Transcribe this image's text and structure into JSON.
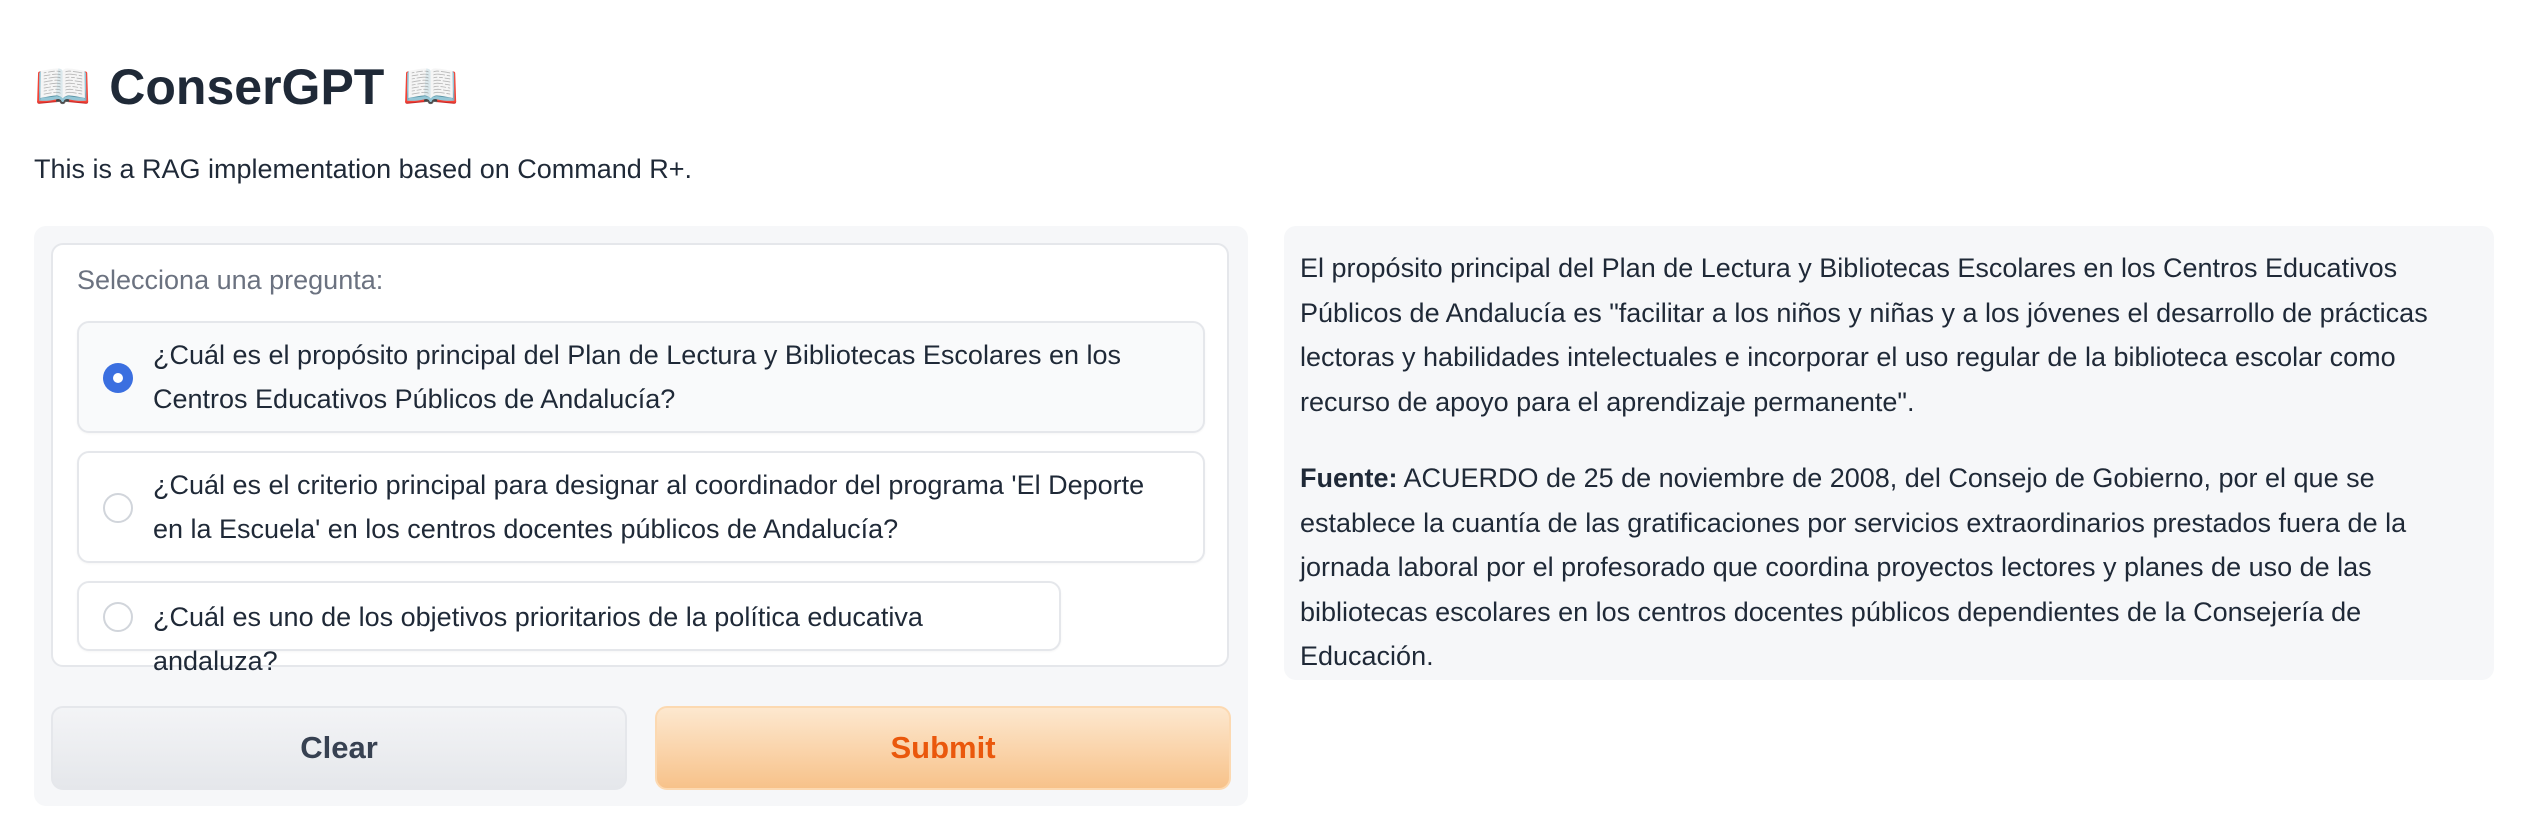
{
  "app": {
    "title": "ConserGPT",
    "title_icon": "open-book-icon",
    "description": "This is a RAG implementation based on Command R+."
  },
  "question_selector": {
    "label": "Selecciona una pregunta:",
    "selected_index": 0,
    "options": [
      "¿Cuál es el propósito principal del Plan de Lectura y Bibliotecas Escolares en los Centros Educativos Públicos de Andalucía?",
      "¿Cuál es el criterio principal para designar al coordinador del programa 'El Deporte en la Escuela' en los centros docentes públicos de Andalucía?",
      "¿Cuál es uno de los objetivos prioritarios de la política educativa andaluza?"
    ]
  },
  "buttons": {
    "clear_label": "Clear",
    "submit_label": "Submit"
  },
  "answer": {
    "text": "El propósito principal del Plan de Lectura y Bibliotecas Escolares en los Centros Educativos Públicos de Andalucía es \"facilitar a los niños y niñas y a los jóvenes el desarrollo de prácticas lectoras y habilidades intelectuales e incorporar el uso regular de la biblioteca escolar como recurso de apoyo para el aprendizaje permanente\".",
    "source_label": "Fuente:",
    "source_text": "ACUERDO de 25 de noviembre de 2008, del Consejo de Gobierno, por el que se establece la cuantía de las gratificaciones por servicios extraordinarios prestados fuera de la jornada laboral por el profesorado que coordina proyectos lectores y planes de uso de las bibliotecas escolares en los centros docentes públicos dependientes de la Consejería de Educación."
  },
  "colors": {
    "accent_radio": "#3b6fe0",
    "submit_text": "#ea580c",
    "submit_bg": "#f7c28a",
    "panel_bg": "#f6f7f9"
  }
}
